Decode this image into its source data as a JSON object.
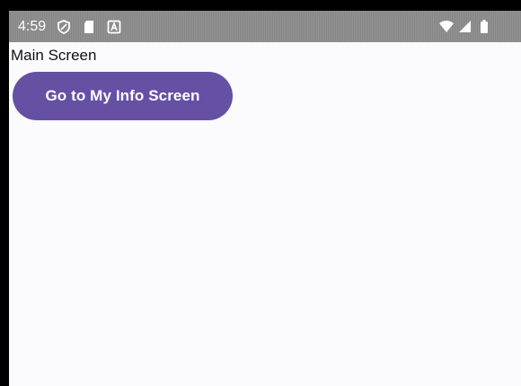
{
  "status_bar": {
    "time": "4:59",
    "left_icons": [
      "shield-icon",
      "sd-card-icon",
      "a-notification-icon"
    ],
    "right_icons": [
      "wifi-icon",
      "cell-signal-icon",
      "battery-icon"
    ],
    "background_color": "#8b8b8b"
  },
  "main": {
    "title": "Main Screen",
    "button_label": "Go to My Info Screen",
    "button_color": "#6650a4"
  }
}
